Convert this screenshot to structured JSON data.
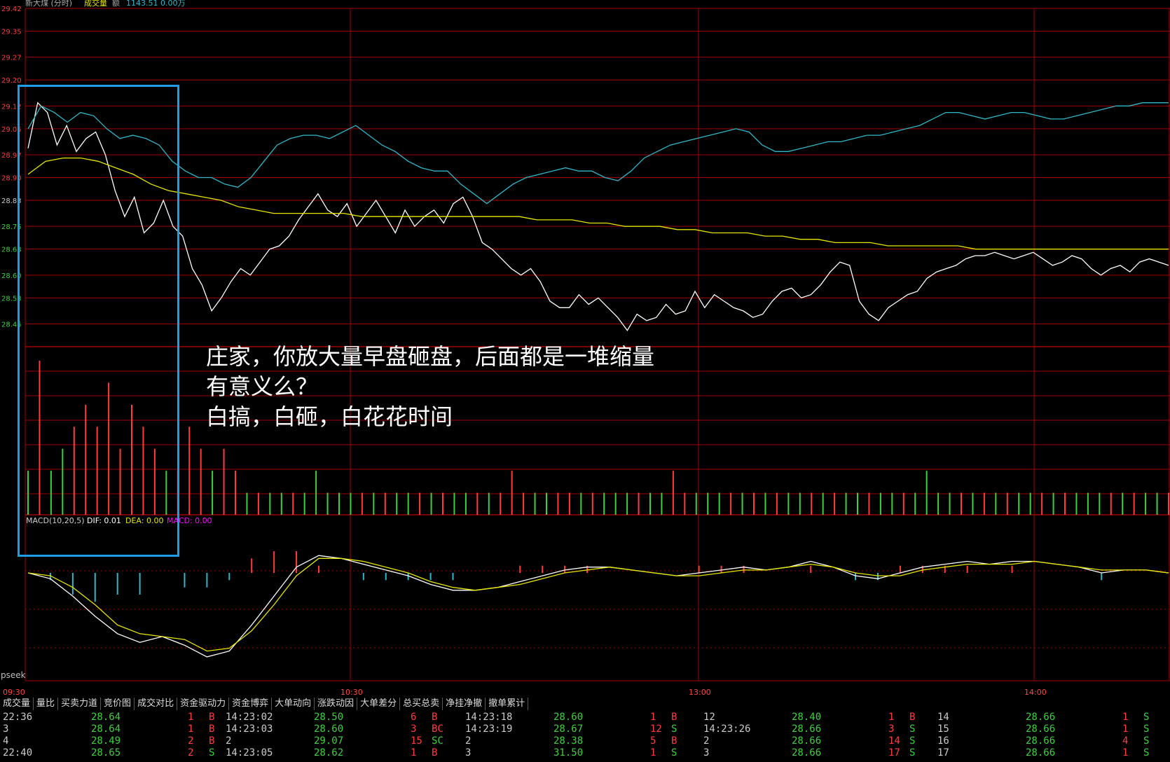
{
  "header": {
    "title": "新大煤",
    "mode": "分时",
    "indicator": "成交量",
    "extra": "额",
    "value_text": "1143.51 0.00万"
  },
  "colors": {
    "up": "#ff3b3b",
    "down": "#3bd13b",
    "price": "#ffffff",
    "avg": "#e6e600",
    "index": "#2fb8c8",
    "grid": "#a00000",
    "box": "#1e9ee8",
    "dea": "#e6e600",
    "macd": "#ff00ff"
  },
  "chart_data": {
    "type": "line",
    "price_axis": {
      "ylim": [
        28.38,
        29.42
      ],
      "ticks": [
        "29.42",
        "29.35",
        "29.27",
        "29.20",
        "29.12",
        "29.05",
        "28.97",
        "28.90",
        "28.83",
        "28.75",
        "28.68",
        "28.60",
        "28.53",
        "28.45"
      ]
    },
    "time_axis": {
      "ticks": [
        "09:30",
        "10:30",
        "13:00",
        "14:00"
      ]
    },
    "series": [
      {
        "key": "price",
        "values": [
          28.99,
          29.13,
          29.1,
          29.0,
          29.06,
          28.98,
          29.02,
          29.04,
          28.97,
          28.86,
          28.78,
          28.84,
          28.73,
          28.76,
          28.83,
          28.75,
          28.72,
          28.62,
          28.57,
          28.49,
          28.53,
          28.58,
          28.62,
          28.6,
          28.64,
          28.68,
          28.69,
          28.72,
          28.77,
          28.81,
          28.85,
          28.8,
          28.78,
          28.82,
          28.75,
          28.79,
          28.83,
          28.78,
          28.73,
          28.8,
          28.75,
          28.78,
          28.8,
          28.76,
          28.82,
          28.84,
          28.78,
          28.7,
          28.68,
          28.65,
          28.62,
          28.6,
          28.62,
          28.58,
          28.52,
          28.5,
          28.5,
          28.54,
          28.51,
          28.53,
          28.5,
          28.47,
          28.43,
          28.48,
          28.46,
          28.47,
          28.51,
          28.48,
          28.49,
          28.55,
          28.5,
          28.54,
          28.52,
          28.5,
          28.49,
          28.47,
          28.48,
          28.52,
          28.55,
          28.56,
          28.53,
          28.54,
          28.57,
          28.61,
          28.64,
          28.63,
          28.52,
          28.48,
          28.46,
          28.5,
          28.52,
          28.54,
          28.55,
          28.59,
          28.61,
          28.62,
          28.63,
          28.65,
          28.66,
          28.66,
          28.67,
          28.66,
          28.65,
          28.66,
          28.67,
          28.65,
          28.63,
          28.64,
          28.66,
          28.65,
          28.62,
          28.6,
          28.62,
          28.63,
          28.61,
          28.64,
          28.65,
          28.64,
          28.63
        ]
      },
      {
        "key": "avg",
        "values": [
          28.91,
          28.95,
          28.96,
          28.96,
          28.95,
          28.93,
          28.91,
          28.88,
          28.86,
          28.85,
          28.84,
          28.83,
          28.81,
          28.8,
          28.79,
          28.79,
          28.79,
          28.79,
          28.79,
          28.78,
          28.78,
          28.78,
          28.78,
          28.78,
          28.78,
          28.78,
          28.78,
          28.78,
          28.78,
          28.77,
          28.77,
          28.77,
          28.76,
          28.76,
          28.75,
          28.75,
          28.75,
          28.74,
          28.74,
          28.73,
          28.73,
          28.73,
          28.72,
          28.72,
          28.71,
          28.71,
          28.7,
          28.7,
          28.7,
          28.69,
          28.69,
          28.69,
          28.69,
          28.69,
          28.68,
          28.68,
          28.68,
          28.68,
          28.68,
          28.68,
          28.68,
          28.68,
          28.68,
          28.68,
          28.68,
          28.68
        ]
      },
      {
        "key": "index",
        "values": [
          29.05,
          29.12,
          29.1,
          29.07,
          29.1,
          29.09,
          29.05,
          29.02,
          29.03,
          29.02,
          29.0,
          28.95,
          28.92,
          28.9,
          28.9,
          28.88,
          28.87,
          28.9,
          28.95,
          29.0,
          29.02,
          29.03,
          29.03,
          29.02,
          29.04,
          29.06,
          29.03,
          29.0,
          28.98,
          28.95,
          28.93,
          28.92,
          28.92,
          28.88,
          28.85,
          28.82,
          28.85,
          28.88,
          28.9,
          28.91,
          28.92,
          28.93,
          28.92,
          28.92,
          28.9,
          28.89,
          28.92,
          28.96,
          28.98,
          29.0,
          29.01,
          29.02,
          29.03,
          29.04,
          29.05,
          29.04,
          29.0,
          28.98,
          28.98,
          28.99,
          29.0,
          29.01,
          29.01,
          29.02,
          29.03,
          29.03,
          29.04,
          29.05,
          29.06,
          29.08,
          29.1,
          29.1,
          29.09,
          29.08,
          29.09,
          29.1,
          29.1,
          29.09,
          29.08,
          29.08,
          29.09,
          29.1,
          29.11,
          29.12,
          29.12,
          29.13,
          29.13,
          29.13
        ]
      }
    ],
    "volume": {
      "values": [
        [
          2,
          1
        ],
        [
          7,
          0
        ],
        [
          2,
          1
        ],
        [
          3,
          1
        ],
        [
          4,
          0
        ],
        [
          5,
          0
        ],
        [
          4,
          0
        ],
        [
          6,
          0
        ],
        [
          3,
          0
        ],
        [
          5,
          0
        ],
        [
          4,
          0
        ],
        [
          3,
          0
        ],
        [
          2,
          1
        ],
        [
          2,
          0
        ],
        [
          4,
          0
        ],
        [
          3,
          0
        ],
        [
          2,
          1
        ],
        [
          3,
          0
        ],
        [
          2,
          0
        ],
        [
          1,
          1
        ],
        [
          1,
          0
        ],
        [
          1,
          1
        ],
        [
          1,
          1
        ],
        [
          1,
          0
        ],
        [
          1,
          1
        ],
        [
          2,
          1
        ],
        [
          1,
          1
        ],
        [
          1,
          1
        ],
        [
          1,
          1
        ],
        [
          1,
          0
        ],
        [
          1,
          1
        ],
        [
          1,
          0
        ],
        [
          1,
          1
        ],
        [
          1,
          1
        ],
        [
          1,
          0
        ],
        [
          1,
          1
        ],
        [
          1,
          0
        ],
        [
          1,
          1
        ],
        [
          1,
          1
        ],
        [
          1,
          0
        ],
        [
          1,
          1
        ],
        [
          1,
          0
        ],
        [
          2,
          0
        ],
        [
          1,
          0
        ],
        [
          1,
          1
        ],
        [
          1,
          1
        ],
        [
          1,
          0
        ],
        [
          1,
          0
        ],
        [
          1,
          1
        ],
        [
          1,
          0
        ],
        [
          1,
          1
        ],
        [
          1,
          1
        ],
        [
          1,
          1
        ],
        [
          1,
          0
        ],
        [
          1,
          1
        ],
        [
          1,
          1
        ],
        [
          2,
          0
        ],
        [
          1,
          0
        ],
        [
          1,
          1
        ],
        [
          1,
          1
        ],
        [
          1,
          1
        ],
        [
          1,
          0
        ],
        [
          1,
          1
        ],
        [
          1,
          0
        ],
        [
          1,
          1
        ],
        [
          1,
          0
        ],
        [
          1,
          1
        ],
        [
          1,
          1
        ],
        [
          1,
          0
        ],
        [
          1,
          1
        ],
        [
          1,
          0
        ],
        [
          1,
          1
        ],
        [
          1,
          1
        ],
        [
          1,
          0
        ],
        [
          1,
          1
        ],
        [
          1,
          1
        ],
        [
          1,
          0
        ],
        [
          1,
          1
        ],
        [
          2,
          1
        ],
        [
          1,
          1
        ],
        [
          1,
          1
        ],
        [
          1,
          0
        ],
        [
          1,
          1
        ],
        [
          1,
          0
        ],
        [
          1,
          1
        ],
        [
          1,
          0
        ],
        [
          1,
          1
        ],
        [
          1,
          1
        ],
        [
          1,
          0
        ],
        [
          1,
          1
        ],
        [
          1,
          0
        ],
        [
          1,
          1
        ],
        [
          1,
          1
        ],
        [
          1,
          1
        ],
        [
          1,
          0
        ],
        [
          1,
          1
        ],
        [
          1,
          0
        ],
        [
          1,
          1
        ],
        [
          1,
          1
        ],
        [
          1,
          0
        ]
      ]
    },
    "macd": {
      "label": "MACD(10,20,5)",
      "dif_label": "DIF: 0.01",
      "dea_label": "DEA: 0.00",
      "macd_label": "MACD: 0.00",
      "dif": [
        0,
        -0.02,
        -0.08,
        -0.15,
        -0.21,
        -0.24,
        -0.22,
        -0.25,
        -0.29,
        -0.27,
        -0.18,
        -0.08,
        0.02,
        0.06,
        0.05,
        0.03,
        0.01,
        -0.01,
        -0.04,
        -0.06,
        -0.06,
        -0.05,
        -0.03,
        -0.01,
        0.01,
        0.02,
        0.02,
        0.01,
        0.0,
        -0.01,
        0.0,
        0.01,
        0.02,
        0.01,
        0.02,
        0.04,
        0.02,
        -0.01,
        -0.02,
        0.0,
        0.02,
        0.03,
        0.04,
        0.03,
        0.04,
        0.04,
        0.03,
        0.02,
        0.0,
        0.01,
        0.01,
        0.0
      ],
      "dea": [
        0,
        -0.01,
        -0.05,
        -0.11,
        -0.18,
        -0.21,
        -0.22,
        -0.23,
        -0.27,
        -0.26,
        -0.2,
        -0.11,
        -0.01,
        0.05,
        0.05,
        0.04,
        0.02,
        0.0,
        -0.03,
        -0.05,
        -0.06,
        -0.05,
        -0.04,
        -0.02,
        0.0,
        0.01,
        0.02,
        0.01,
        0.0,
        -0.01,
        -0.01,
        0.0,
        0.01,
        0.01,
        0.02,
        0.03,
        0.02,
        0.0,
        -0.01,
        -0.01,
        0.01,
        0.02,
        0.03,
        0.03,
        0.03,
        0.04,
        0.03,
        0.02,
        0.01,
        0.01,
        0.01,
        0.0
      ]
    }
  },
  "tabs": [
    "成交量",
    "量比",
    "买卖力道",
    "竞价图",
    "成交对比",
    "资金驱动力",
    "资金博弈",
    "大单动向",
    "涨跌动因",
    "大单差分",
    "总买总卖",
    "净挂净撤",
    "撤单累计"
  ],
  "ticks": [
    [
      {
        "t": "22:36",
        "p": "28.64",
        "v": "1",
        "s": "B"
      },
      {
        "t": "3",
        "p": "28.64",
        "v": "1",
        "s": "B"
      },
      {
        "t": "4",
        "p": "28.49",
        "v": "2",
        "s": "B"
      },
      {
        "t": "22:40",
        "p": "28.65",
        "v": "2",
        "s": "S"
      }
    ],
    [
      {
        "t": "14:23:02",
        "p": "28.50",
        "v": "6",
        "s": "B"
      },
      {
        "t": "14:23:03",
        "p": "28.60",
        "v": "3",
        "s": "BC"
      },
      {
        "t": "2",
        "p": "29.07",
        "v": "15",
        "s": "SC"
      },
      {
        "t": "14:23:05",
        "p": "28.62",
        "v": "1",
        "s": "B"
      }
    ],
    [
      {
        "t": "14:23:18",
        "p": "28.60",
        "v": "1",
        "s": "B"
      },
      {
        "t": "14:23:19",
        "p": "28.67",
        "v": "12",
        "s": "S"
      },
      {
        "t": "2",
        "p": "28.38",
        "v": "5",
        "s": "B"
      },
      {
        "t": "3",
        "p": "31.50",
        "v": "1",
        "s": "S"
      }
    ],
    [
      {
        "t": "12",
        "p": "28.40",
        "v": "1",
        "s": "B"
      },
      {
        "t": "14:23:26",
        "p": "28.66",
        "v": "3",
        "s": "S"
      },
      {
        "t": "2",
        "p": "28.66",
        "v": "14",
        "s": "S"
      },
      {
        "t": "3",
        "p": "28.66",
        "v": "17",
        "s": "S"
      }
    ],
    [
      {
        "t": "14",
        "p": "28.66",
        "v": "1",
        "s": "S"
      },
      {
        "t": "15",
        "p": "28.66",
        "v": "1",
        "s": "S"
      },
      {
        "t": "16",
        "p": "28.66",
        "v": "4",
        "s": "S"
      },
      {
        "t": "17",
        "p": "28.66",
        "v": "1",
        "s": "S"
      }
    ]
  ],
  "annotation": {
    "line1": "庄家，你放大量早盘砸盘，后面都是一堆缩量",
    "line2": "有意义么？",
    "line3": "白搞，白砸，白花花时间"
  },
  "watermark": "pseek"
}
